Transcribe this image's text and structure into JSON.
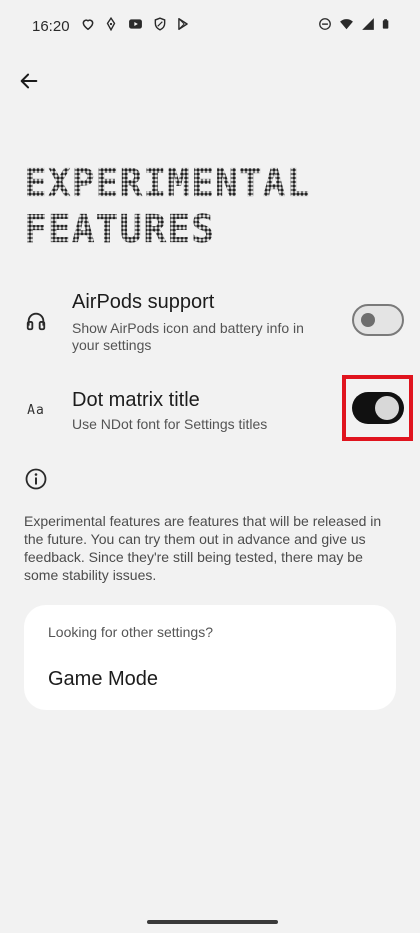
{
  "status_bar": {
    "time": "16:20",
    "left_icons": [
      "heart-icon",
      "leaf-icon",
      "youtube-icon",
      "shield-icon",
      "play-store-icon"
    ],
    "right_icons": [
      "do-not-disturb-icon",
      "wifi-icon",
      "signal-icon",
      "battery-icon"
    ]
  },
  "header": {
    "back_icon": "arrow-back-icon"
  },
  "title": {
    "line1": "EXPERIMENTAL",
    "line2": "FEATURES"
  },
  "settings": [
    {
      "icon": "headphones-icon",
      "title": "AirPods support",
      "subtitle": "Show AirPods icon and battery info in your settings",
      "enabled": false
    },
    {
      "icon": "dot-font-icon",
      "icon_text": "Aa",
      "title": "Dot matrix title",
      "subtitle": "Use NDot font for Settings titles",
      "enabled": true
    }
  ],
  "info": {
    "icon": "info-icon",
    "text": "Experimental features are features that will be released in the future. You can try them out in advance and give us feedback. Since they're still being tested, there may be some stability issues."
  },
  "card": {
    "hint": "Looking for other settings?",
    "link": "Game Mode"
  },
  "colors": {
    "background": "#f2f2f2",
    "switch_on": "#111111",
    "highlight": "#e0141e"
  }
}
